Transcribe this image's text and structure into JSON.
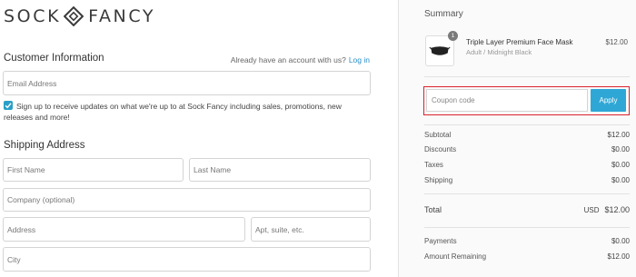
{
  "brand": {
    "left": "SOCK",
    "right": "FANCY"
  },
  "customer": {
    "title": "Customer Information",
    "login_prompt": "Already have an account with us?",
    "login_link": "Log in",
    "email_placeholder": "Email Address",
    "newsletter_text": "Sign up to receive updates on what we're up to at Sock Fancy including sales, promotions, new releases and more!",
    "newsletter_checked": true
  },
  "shipping": {
    "title": "Shipping Address",
    "first_name": "First Name",
    "last_name": "Last Name",
    "company": "Company (optional)",
    "address": "Address",
    "apt": "Apt, suite, etc.",
    "city": "City"
  },
  "summary": {
    "title": "Summary",
    "item": {
      "quantity": "1",
      "name": "Triple Layer Premium Face Mask",
      "variant": "Adult / Midnight Black",
      "price": "$12.00"
    },
    "coupon_placeholder": "Coupon code",
    "apply_label": "Apply",
    "rows": [
      {
        "label": "Subtotal",
        "value": "$12.00"
      },
      {
        "label": "Discounts",
        "value": "$0.00"
      },
      {
        "label": "Taxes",
        "value": "$0.00"
      },
      {
        "label": "Shipping",
        "value": "$0.00"
      }
    ],
    "total": {
      "label": "Total",
      "currency": "USD",
      "value": "$12.00"
    },
    "payments": {
      "label": "Payments",
      "value": "$0.00"
    },
    "remaining": {
      "label": "Amount Remaining",
      "value": "$12.00"
    }
  },
  "colors": {
    "accent": "#2ea7d6",
    "highlight_border": "#d9232d",
    "checkbox": "#2a9fc7"
  }
}
